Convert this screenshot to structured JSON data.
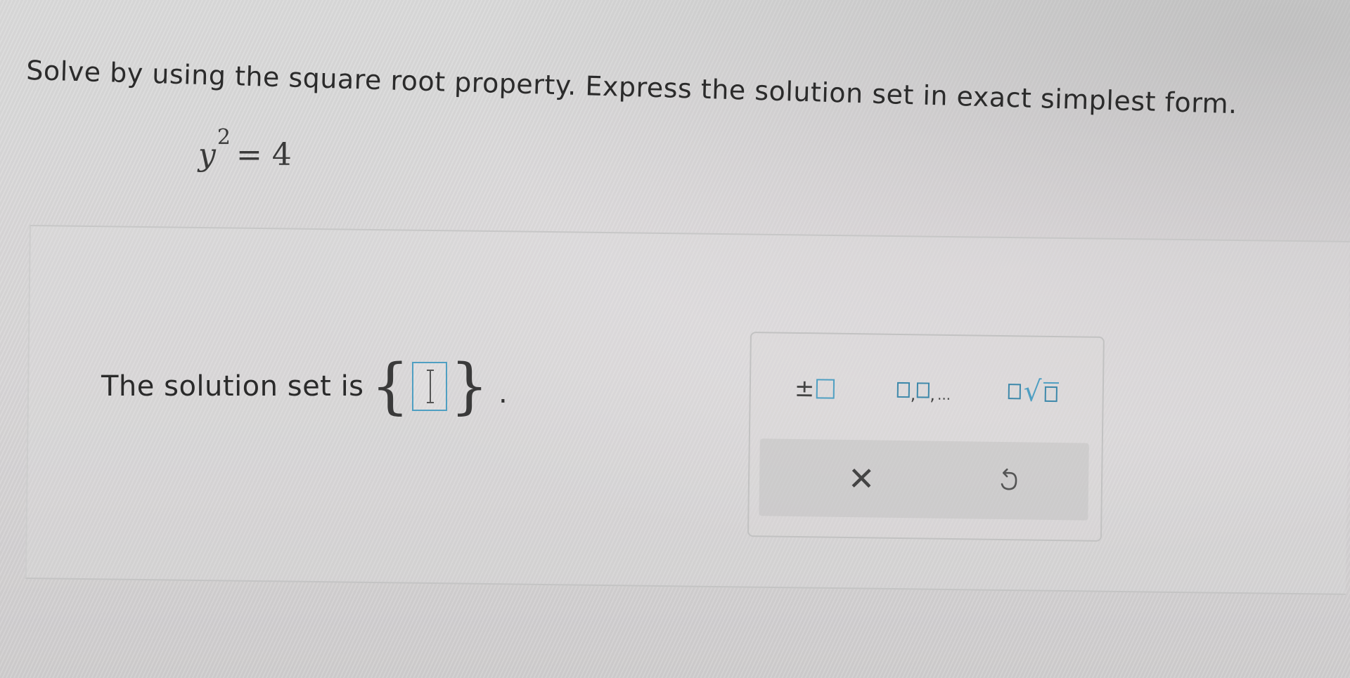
{
  "question": {
    "instruction": "Solve by using the square root property. Express the solution set in exact simplest form.",
    "equation": {
      "variable": "y",
      "exponent": "2",
      "rhs": "= 4"
    }
  },
  "answer": {
    "label": "The solution set is",
    "open_brace": "{",
    "close_brace": "}",
    "terminator": ".",
    "input_value": ""
  },
  "palette": {
    "plus_minus": {
      "symbol": "±",
      "icon": "plus-minus-box-icon"
    },
    "list": {
      "comma": ",",
      "ellipsis": "...",
      "icon": "list-boxes-icon"
    },
    "sqrt": {
      "radical": "√",
      "icon": "square-root-icon"
    },
    "clear": {
      "symbol": "✕",
      "icon": "close-icon"
    },
    "undo": {
      "icon": "undo-icon"
    },
    "accent_color": "#4f9fc2"
  }
}
